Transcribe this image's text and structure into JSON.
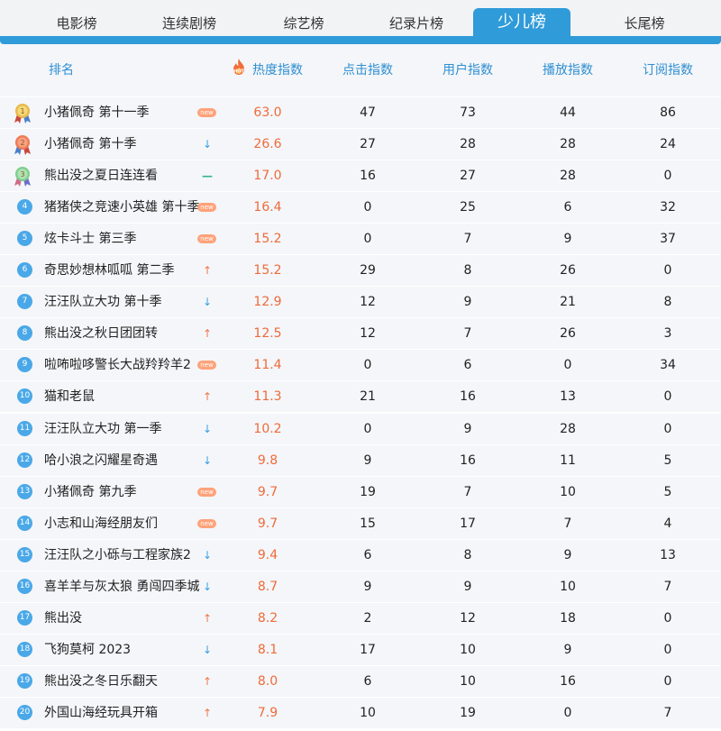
{
  "tabs": [
    {
      "label": "电影榜",
      "active": false
    },
    {
      "label": "连续剧榜",
      "active": false
    },
    {
      "label": "综艺榜",
      "active": false
    },
    {
      "label": "纪录片榜",
      "active": false
    },
    {
      "label": "少儿榜",
      "active": true
    },
    {
      "label": "长尾榜",
      "active": false
    }
  ],
  "header": {
    "rank": "排名",
    "hot_badge": "HOT",
    "heat": "热度指数",
    "click": "点击指数",
    "user": "用户指数",
    "play": "播放指数",
    "subscribe": "订阅指数"
  },
  "colors": {
    "accent": "#2f9bd9",
    "heat_value": "#ef6a3a",
    "trend_up": "#f0764a",
    "trend_down": "#3a9ee0",
    "trend_flat": "#2fb58c"
  },
  "rows": [
    {
      "rank": "1",
      "name": "小猪佩奇 第十一季",
      "trend": "new",
      "heat": "63.0",
      "click": "47",
      "user": "73",
      "play": "44",
      "subscribe": "86"
    },
    {
      "rank": "2",
      "name": "小猪佩奇 第十季",
      "trend": "down",
      "heat": "26.6",
      "click": "27",
      "user": "28",
      "play": "28",
      "subscribe": "24"
    },
    {
      "rank": "3",
      "name": "熊出没之夏日连连看",
      "trend": "flat",
      "heat": "17.0",
      "click": "16",
      "user": "27",
      "play": "28",
      "subscribe": "0"
    },
    {
      "rank": "4",
      "name": "猪猪侠之竞速小英雄 第十季",
      "trend": "new",
      "heat": "16.4",
      "click": "0",
      "user": "25",
      "play": "6",
      "subscribe": "32"
    },
    {
      "rank": "5",
      "name": "炫卡斗士 第三季",
      "trend": "new",
      "heat": "15.2",
      "click": "0",
      "user": "7",
      "play": "9",
      "subscribe": "37"
    },
    {
      "rank": "6",
      "name": "奇思妙想林呱呱 第二季",
      "trend": "up",
      "heat": "15.2",
      "click": "29",
      "user": "8",
      "play": "26",
      "subscribe": "0"
    },
    {
      "rank": "7",
      "name": "汪汪队立大功 第十季",
      "trend": "down",
      "heat": "12.9",
      "click": "12",
      "user": "9",
      "play": "21",
      "subscribe": "8"
    },
    {
      "rank": "8",
      "name": "熊出没之秋日团团转",
      "trend": "up",
      "heat": "12.5",
      "click": "12",
      "user": "7",
      "play": "26",
      "subscribe": "3"
    },
    {
      "rank": "9",
      "name": "啦咘啦哆警长大战羚羚羊2",
      "trend": "new",
      "heat": "11.4",
      "click": "0",
      "user": "6",
      "play": "0",
      "subscribe": "34"
    },
    {
      "rank": "10",
      "name": "猫和老鼠",
      "trend": "up",
      "heat": "11.3",
      "click": "21",
      "user": "16",
      "play": "13",
      "subscribe": "0"
    },
    {
      "rank": "11",
      "name": "汪汪队立大功 第一季",
      "trend": "down",
      "heat": "10.2",
      "click": "0",
      "user": "9",
      "play": "28",
      "subscribe": "0"
    },
    {
      "rank": "12",
      "name": "哈小浪之闪耀星奇遇",
      "trend": "down",
      "heat": "9.8",
      "click": "9",
      "user": "16",
      "play": "11",
      "subscribe": "5"
    },
    {
      "rank": "13",
      "name": "小猪佩奇 第九季",
      "trend": "new",
      "heat": "9.7",
      "click": "19",
      "user": "7",
      "play": "10",
      "subscribe": "5"
    },
    {
      "rank": "14",
      "name": "小志和山海经朋友们",
      "trend": "new",
      "heat": "9.7",
      "click": "15",
      "user": "17",
      "play": "7",
      "subscribe": "4"
    },
    {
      "rank": "15",
      "name": "汪汪队之小砾与工程家族2",
      "trend": "down",
      "heat": "9.4",
      "click": "6",
      "user": "8",
      "play": "9",
      "subscribe": "13"
    },
    {
      "rank": "16",
      "name": "喜羊羊与灰太狼 勇闯四季城",
      "trend": "down",
      "heat": "8.7",
      "click": "9",
      "user": "9",
      "play": "10",
      "subscribe": "7"
    },
    {
      "rank": "17",
      "name": "熊出没",
      "trend": "up",
      "heat": "8.2",
      "click": "2",
      "user": "12",
      "play": "18",
      "subscribe": "0"
    },
    {
      "rank": "18",
      "name": "飞狗莫柯 2023",
      "trend": "down",
      "heat": "8.1",
      "click": "17",
      "user": "10",
      "play": "9",
      "subscribe": "0"
    },
    {
      "rank": "19",
      "name": "熊出没之冬日乐翻天",
      "trend": "up",
      "heat": "8.0",
      "click": "6",
      "user": "10",
      "play": "16",
      "subscribe": "0"
    },
    {
      "rank": "20",
      "name": "外国山海经玩具开箱",
      "trend": "up",
      "heat": "7.9",
      "click": "10",
      "user": "19",
      "play": "0",
      "subscribe": "7"
    }
  ]
}
